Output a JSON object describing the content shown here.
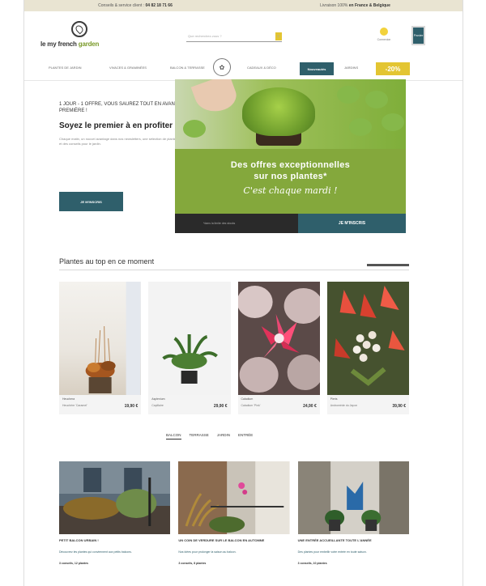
{
  "topbar": {
    "left_prefix": "Conseils & service client :",
    "phone": "04 82 18 71 66",
    "right_prefix": "Livraison 100% ",
    "right_emph": "en France & Belgique"
  },
  "header": {
    "logo": {
      "prefix": "le ",
      "mid": "my french ",
      "brand": "garden"
    },
    "search_placeholder": "Que recherchez-vous ?",
    "account_label": "Connexion",
    "cart_label": "Panier"
  },
  "nav": {
    "items": [
      "Plantes de jardin",
      "Vivaces & graminées",
      "Balcon & terrasse",
      "Cadeaux & déco",
      "Jardins"
    ],
    "emblem_glyph": "✿",
    "dark_button": "Nouveautés",
    "yellow_button": "-20%"
  },
  "hero": {
    "kicker": "1 jour - 1 offre, vous saurez tout en avant-première !",
    "headline": "Soyez le premier à en profiter !",
    "body": "Chaque matin, un nouvel avantage dans nos newsletters, une sélection de plantes et des conseils pour le jardin.",
    "cta": "Je m'inscris"
  },
  "promo": {
    "line1": "Des offres exceptionnelles",
    "line2": "sur nos plantes*",
    "line3": "C'est chaque mardi !",
    "footnote": "*dans la limite des stocks",
    "button": "Je m'inscris"
  },
  "top_plants": {
    "title": "Plantes au top en ce moment",
    "products": [
      {
        "name": "Heuchera",
        "sub": "Heuchère 'Caramel'",
        "price": "19,90 €"
      },
      {
        "name": "Asplenium",
        "sub": "Capillaire",
        "price": "29,90 €"
      },
      {
        "name": "Caladium",
        "sub": "Caladium 'Pink'",
        "price": "24,90 €"
      },
      {
        "name": "Pieris",
        "sub": "Andromède du Japon",
        "price": "39,90 €"
      }
    ]
  },
  "tabs": [
    "Balcon",
    "Terrasse",
    "Jardin",
    "Entrée"
  ],
  "articles": [
    {
      "title": "Petit balcon urbain !",
      "excerpt": "Découvrez les plantes qui conviennent aux petits balcons.",
      "meta": "3 conseils, 12 plantes"
    },
    {
      "title": "Un coin de verdure sur le balcon en automne",
      "excerpt": "Nos idées pour prolonger la saison au balcon.",
      "meta": "3 conseils, 8 plantes"
    },
    {
      "title": "Une entrée accueillante toute l'année",
      "excerpt": "Des plantes pour embellir votre entrée en toute saison.",
      "meta": "3 conseils, 10 plantes"
    }
  ],
  "colors": {
    "teal": "#2f5f6b",
    "yellow": "#e3c532",
    "green": "#84a83c"
  }
}
